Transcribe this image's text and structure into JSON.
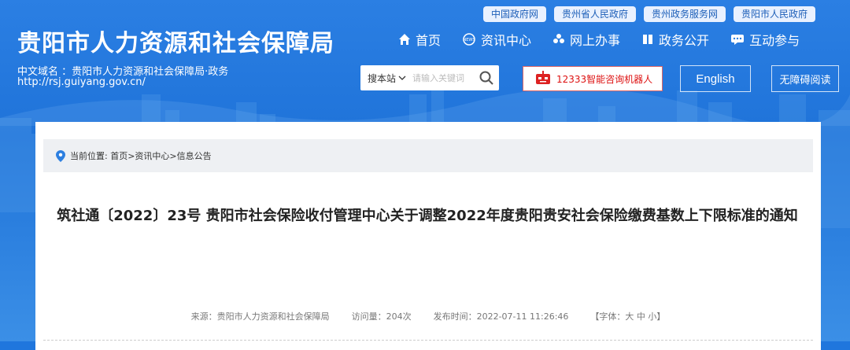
{
  "header": {
    "top_links": [
      "中国政府网",
      "贵州省人民政府",
      "贵州政务服务网",
      "贵阳市人民政府"
    ],
    "site_title": "贵阳市人力资源和社会保障局",
    "domain_label": "中文域名 ：贵阳市人力资源和社会保障局·政务",
    "domain_url": "http://rsj.guiyang.gov.cn/"
  },
  "nav": {
    "items": [
      {
        "label": "首页",
        "icon": "home-icon"
      },
      {
        "label": "资讯中心",
        "icon": "news-icon"
      },
      {
        "label": "网上办事",
        "icon": "service-icon"
      },
      {
        "label": "政务公开",
        "icon": "book-icon"
      },
      {
        "label": "互动参与",
        "icon": "chat-icon"
      }
    ]
  },
  "search": {
    "scope_label": "搜本站",
    "placeholder": "请输入关键词"
  },
  "robot": {
    "label": "12333智能咨询机器人"
  },
  "english_label": "English",
  "accessibility_label": "无障碍阅读",
  "breadcrumb": "当前位置: 首页>资讯中心>信息公告",
  "article": {
    "title": "筑社通〔2022〕23号 贵阳市社会保险收付管理中心关于调整2022年度贵阳贵安社会保险缴费基数上下限标准的通知",
    "source": "来源：贵阳市人力资源和社会保障局",
    "views": "访问量：204次",
    "published": "发布时间：2022-07-11 11:26:46",
    "font_size_label": "【字体：大 中 小】"
  }
}
